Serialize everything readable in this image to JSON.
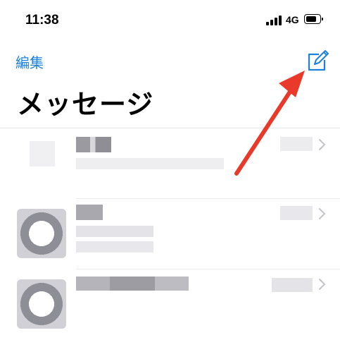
{
  "status_bar": {
    "time": "11:38",
    "network": "4G",
    "battery_level": 0.75
  },
  "nav": {
    "edit_label": "編集",
    "compose_icon": "compose-icon"
  },
  "page_title": "メッセージ",
  "colors": {
    "accent": "#1a82dd",
    "annotation_arrow": "#e8392a",
    "redaction": "#c8c8cc"
  },
  "conversations_redacted": true,
  "conversation_count_visible": 3
}
